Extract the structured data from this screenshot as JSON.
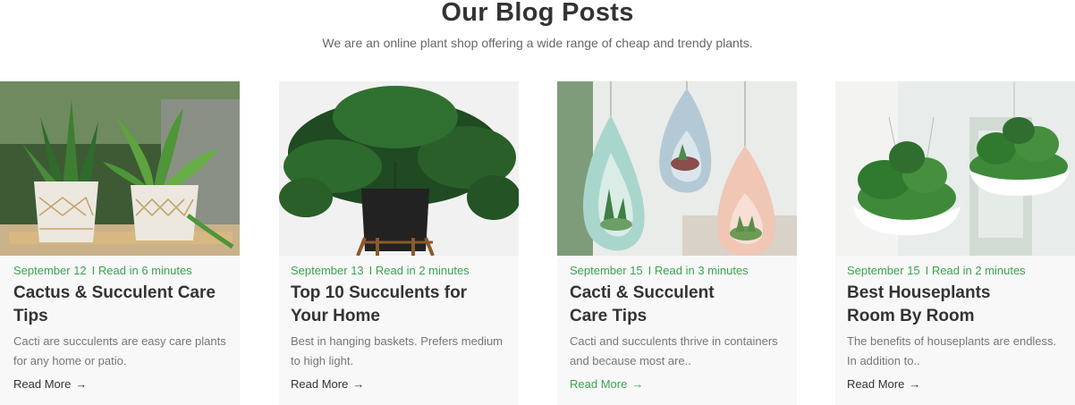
{
  "section": {
    "title": "Our Blog Posts",
    "subtitle": "We are an online plant shop offering a wide range of cheap and trendy plants."
  },
  "posts": [
    {
      "date": "September 12",
      "read_time": "I Read in 6 minutes",
      "title": "Cactus & Succulent Care Tips",
      "excerpt": "Cacti are succulents are easy care plants for any home or patio.",
      "link_label": "Read More",
      "image_icon": "potted-snake-plant-image"
    },
    {
      "date": "September 13",
      "read_time": "I Read in 2 minutes",
      "title": "Top 10 Succulents for Your Home",
      "excerpt": "Best in hanging baskets. Prefers medium to high light.",
      "link_label": "Read More",
      "image_icon": "monstera-plant-image"
    },
    {
      "date": "September 15",
      "read_time": "I Read in 3 minutes",
      "title": "Cacti & Succulent Care Tips",
      "excerpt": "Cacti and succulents thrive in containers and because most are..",
      "link_label": "Read More",
      "image_icon": "hanging-planters-image"
    },
    {
      "date": "September 15",
      "read_time": "I Read in 2 minutes",
      "title": "Best Houseplants Room By Room",
      "excerpt": "The benefits of houseplants are endless. In addition to..",
      "link_label": "Read More",
      "image_icon": "hanging-bowl-plants-image"
    }
  ],
  "colors": {
    "accent": "#3aa34f",
    "card_bg": "#f8f8f8",
    "title": "#333333",
    "muted": "#777777"
  }
}
